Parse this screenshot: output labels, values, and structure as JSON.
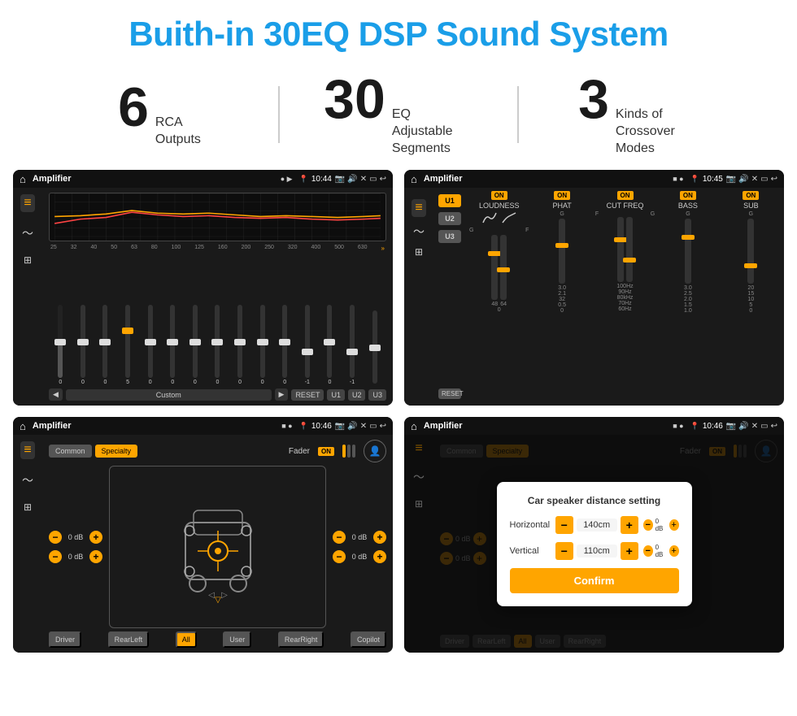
{
  "page": {
    "title": "Buith-in 30EQ DSP Sound System"
  },
  "stats": [
    {
      "number": "6",
      "text": "RCA\nOutputs"
    },
    {
      "number": "30",
      "text": "EQ Adjustable\nSegments"
    },
    {
      "number": "3",
      "text": "Kinds of\nCrossover Modes"
    }
  ],
  "screens": [
    {
      "id": "eq-screen",
      "title": "Amplifier",
      "time": "10:44",
      "type": "eq"
    },
    {
      "id": "crossover-screen",
      "title": "Amplifier",
      "time": "10:45",
      "type": "crossover"
    },
    {
      "id": "fader-screen",
      "title": "Amplifier",
      "time": "10:46",
      "type": "fader"
    },
    {
      "id": "dialog-screen",
      "title": "Amplifier",
      "time": "10:46",
      "type": "dialog"
    }
  ],
  "eq": {
    "frequencies": [
      "25",
      "32",
      "40",
      "50",
      "63",
      "80",
      "100",
      "125",
      "160",
      "200",
      "250",
      "320",
      "400",
      "500",
      "630"
    ],
    "values": [
      "0",
      "0",
      "0",
      "5",
      "0",
      "0",
      "0",
      "0",
      "0",
      "0",
      "0",
      "-1",
      "0",
      "-1",
      ""
    ],
    "sliderPositions": [
      50,
      50,
      50,
      35,
      50,
      50,
      50,
      50,
      50,
      50,
      50,
      60,
      50,
      60,
      50
    ],
    "presets": [
      "Custom",
      "RESET",
      "U1",
      "U2",
      "U3"
    ]
  },
  "crossover": {
    "units": [
      "U1",
      "U2",
      "U3"
    ],
    "cols": [
      "LOUDNESS",
      "PHAT",
      "CUT FREQ",
      "BASS",
      "SUB"
    ],
    "sliderPositions": [
      70,
      50,
      40,
      60,
      80
    ]
  },
  "fader": {
    "tabs": [
      "Common",
      "Specialty"
    ],
    "activeTab": "Specialty",
    "faderLabel": "Fader",
    "faderOn": "ON",
    "dbValues": [
      "0 dB",
      "0 dB",
      "0 dB",
      "0 dB"
    ],
    "bottomBtns": [
      "Driver",
      "RearLeft",
      "All",
      "User",
      "RearRight",
      "Copilot"
    ]
  },
  "dialog": {
    "title": "Car speaker distance setting",
    "horizontal": {
      "label": "Horizontal",
      "value": "140cm"
    },
    "vertical": {
      "label": "Vertical",
      "value": "110cm"
    },
    "confirmLabel": "Confirm"
  }
}
